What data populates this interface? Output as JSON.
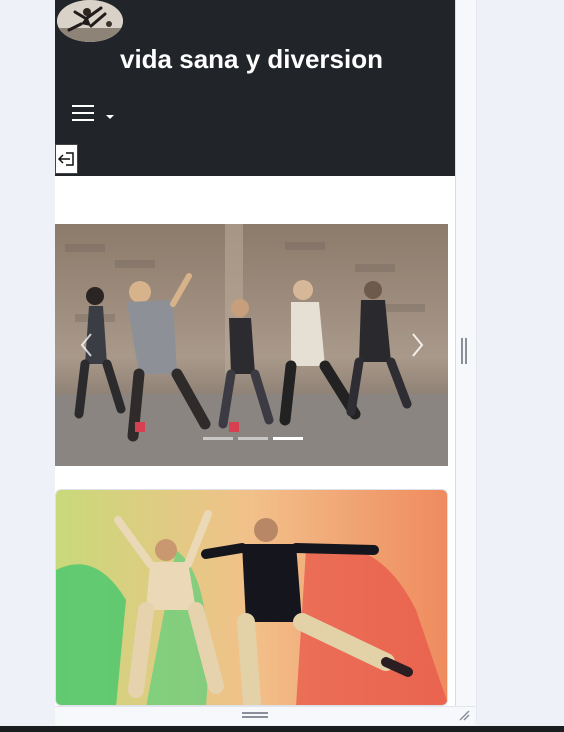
{
  "header": {
    "site_title": "vida sana y diversion",
    "logo": "breakdancer-logo",
    "menu_icon": "hamburger-icon",
    "dropdown_icon": "caret-down-icon",
    "back_icon": "arrow-left-exit-icon"
  },
  "carousel": {
    "image": "group-dancers-photo",
    "prev_icon": "chevron-left-icon",
    "next_icon": "chevron-right-icon",
    "slide_count": 3,
    "active_index": 2
  },
  "card": {
    "image": "dancing-couple-photo"
  },
  "colors": {
    "header_bg": "#212529",
    "page_bg": "#eef1f8",
    "text_light": "#ffffff"
  }
}
